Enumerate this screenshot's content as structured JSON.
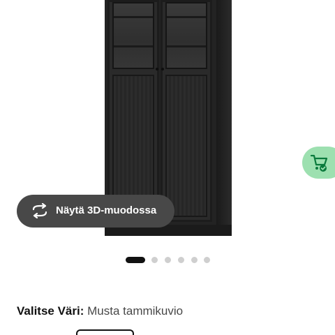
{
  "product": {
    "image_alt": "",
    "view3d_label": "Näytä 3D-muodossa"
  },
  "carousel": {
    "count": 6,
    "active_index": 0
  },
  "color": {
    "label": "Valitse Väri:",
    "value": "Musta tammikuvio"
  },
  "icons": {
    "view3d": "rotate-3d-icon",
    "cart": "cart-check-icon"
  },
  "colors": {
    "cart_fab_bg": "#9de0b0",
    "view3d_bg": "#484848",
    "dot_active": "#111111",
    "dot_inactive": "#cfcfcf"
  }
}
